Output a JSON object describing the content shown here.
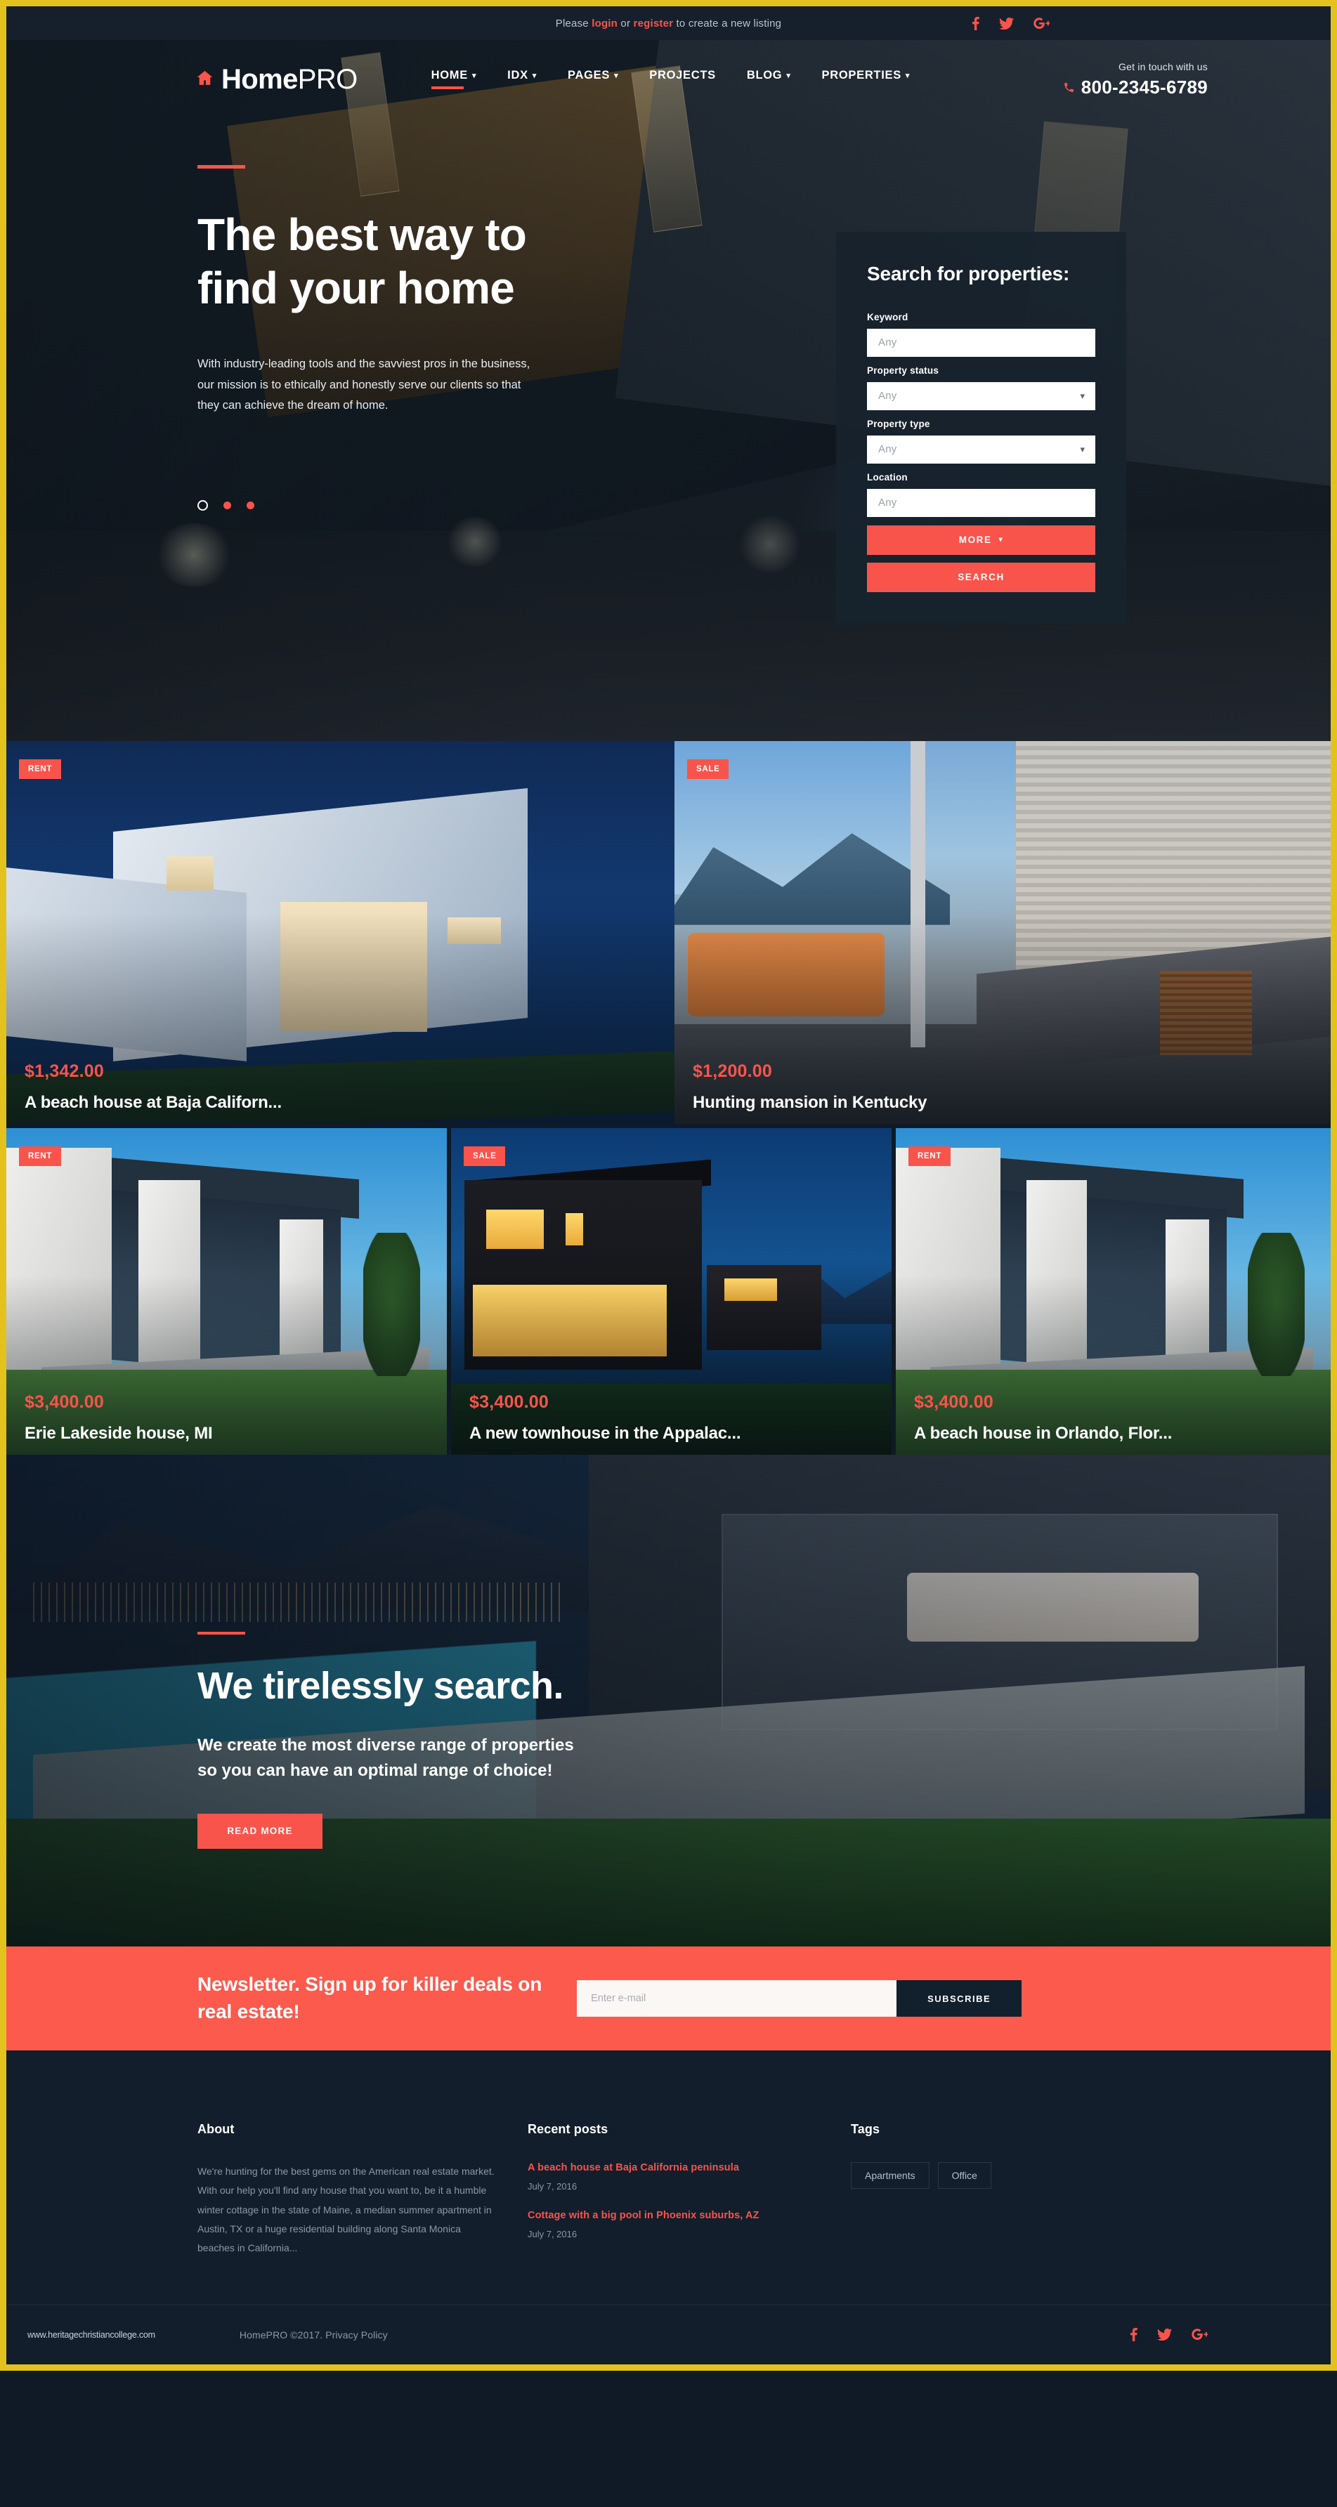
{
  "topbar": {
    "notice_prefix": "Please ",
    "login_label": "login",
    "notice_mid": " or ",
    "register_label": "register",
    "notice_suffix": " to create a new listing",
    "social": [
      {
        "name": "facebook",
        "label": "f"
      },
      {
        "name": "twitter",
        "label": "t"
      },
      {
        "name": "google-plus",
        "label": "G+"
      }
    ]
  },
  "header": {
    "brand_bold": "Home",
    "brand_light": "PRO",
    "nav": [
      {
        "label": "HOME",
        "caret": true,
        "active": true
      },
      {
        "label": "IDX",
        "caret": true,
        "active": false
      },
      {
        "label": "PAGES",
        "caret": true,
        "active": false
      },
      {
        "label": "PROJECTS",
        "caret": false,
        "active": false
      },
      {
        "label": "BLOG",
        "caret": true,
        "active": false
      },
      {
        "label": "PROPERTIES",
        "caret": true,
        "active": false
      }
    ],
    "contact_label": "Get in touch with us",
    "phone": "800-2345-6789"
  },
  "hero": {
    "title_line1": "The best way to",
    "title_line2": "find your home",
    "paragraph": "With industry-leading tools and the savviest pros in the business, our mission is to ethically and honestly serve our clients so that they can achieve the dream of home.",
    "slides": 3,
    "active_slide": 0
  },
  "search_panel": {
    "heading": "Search for properties:",
    "fields": [
      {
        "label": "Keyword",
        "value": "Any",
        "type": "text"
      },
      {
        "label": "Property status",
        "value": "Any",
        "type": "select"
      },
      {
        "label": "Property type",
        "value": "Any",
        "type": "select"
      },
      {
        "label": "Location",
        "value": "Any",
        "type": "text"
      }
    ],
    "more_label": "MORE",
    "search_label": "SEARCH"
  },
  "listings_row1": [
    {
      "badge": "RENT",
      "price": "$1,342.00",
      "name": "A beach house at Baja Californ...",
      "scene": "baja"
    },
    {
      "badge": "SALE",
      "price": "$1,200.00",
      "name": "Hunting mansion in Kentucky",
      "scene": "kentucky"
    }
  ],
  "listings_row2": [
    {
      "badge": "RENT",
      "price": "$3,400.00",
      "name": "Erie Lakeside house, MI",
      "scene": "erie"
    },
    {
      "badge": "SALE",
      "price": "$3,400.00",
      "name": "A new townhouse in the Appalac...",
      "scene": "appalachia"
    },
    {
      "badge": "RENT",
      "price": "$3,400.00",
      "name": "A beach house in Orlando, Flor...",
      "scene": "orlando"
    }
  ],
  "cta": {
    "heading": "We tirelessly search.",
    "paragraph_line1": "We create the most diverse range of properties",
    "paragraph_line2": "so you can have an optimal range of choice!",
    "button_label": "READ MORE"
  },
  "newsletter": {
    "heading_line1": "Newsletter. Sign up for killer deals on",
    "heading_line2": "real estate!",
    "input_placeholder": "Enter e-mail",
    "input_value": "",
    "button_label": "SUBSCRIBE"
  },
  "footer": {
    "about_heading": "About",
    "about_text": "We're hunting for the best gems on the American real estate market. With our help you'll find any house that you want to, be it a humble winter cottage in the state of Maine, a median summer apartment in Austin, TX or a huge residential building along Santa Monica beaches in California...",
    "posts_heading": "Recent posts",
    "posts": [
      {
        "title": "A beach house at Baja California peninsula",
        "date": "July 7, 2016"
      },
      {
        "title": "Cottage with a big pool in Phoenix suburbs, AZ",
        "date": "July 7, 2016"
      }
    ],
    "tags_heading": "Tags",
    "tags": [
      "Apartments",
      "Office"
    ],
    "watermark": "www.heritagechristiancollege.com",
    "copyright": "HomePRO ©2017. Privacy Policy",
    "social": [
      {
        "name": "facebook",
        "label": "f"
      },
      {
        "name": "twitter",
        "label": "t"
      },
      {
        "name": "google-plus",
        "label": "G+"
      }
    ]
  },
  "colors": {
    "accent": "#f9544b",
    "newsletter_bg": "#fb5a4c",
    "dark": "#121e2b",
    "border": "#e3c21e"
  }
}
